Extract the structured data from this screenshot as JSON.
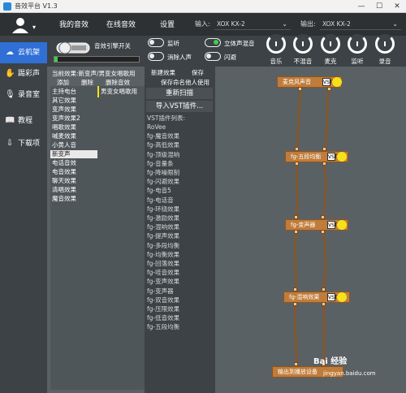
{
  "window": {
    "title": "音效平台 V1.3",
    "minimize": "—",
    "maximize": "☐",
    "close": "✕"
  },
  "tabs": [
    "我的音效",
    "在线音效",
    "设置"
  ],
  "input": {
    "label": "输入:",
    "value": "XOX KX-2"
  },
  "output": {
    "label": "输出:",
    "value": "XOX KX-2"
  },
  "sidebar": {
    "items": [
      "云机架",
      "踢彩声",
      "录音室",
      "教程",
      "下载项"
    ]
  },
  "engine": {
    "label": "音效引擎开关"
  },
  "switches": [
    {
      "label": "监听",
      "on": false
    },
    {
      "label": "立体声混音",
      "on": true
    },
    {
      "label": "消除人声",
      "on": false
    },
    {
      "label": "闪避",
      "on": false
    }
  ],
  "knobs": [
    "音乐",
    "不混音",
    "麦克",
    "监听",
    "录音"
  ],
  "current_effect": {
    "label": "当前效果:新变声/男变女唱歌用"
  },
  "actions": {
    "add": "添加",
    "delete": "删除",
    "delete_effect": "删除音效"
  },
  "effects_list": [
    "主持电台",
    "其它效果",
    "变声效果",
    "变声效果2",
    "唱歌效果",
    "喊麦效果",
    "小黄人音",
    "新变声",
    "电话音效",
    "电音效果",
    "聊天效果",
    "清唱效果",
    "魔音效果"
  ],
  "selected_effect": "新变声",
  "sub_list": [
    "男变女唱歌用"
  ],
  "mid": {
    "new_effect": "新建效果",
    "save": "保存",
    "save_named": "保存命名他人使用",
    "rescan": "重新扫描",
    "import_vst": "导入VST插件...",
    "vst_header": "VST插件列表:",
    "vst_list": [
      "RoVee",
      "fg-魔音效果",
      "fg-高低效果",
      "fg-顶级混响",
      "fg-音量条",
      "fg-降噪限制",
      "fg-闪避效果",
      "fg-电音5",
      "fg-电话音",
      "fg-环绕效果",
      "fg-激励效果",
      "fg-混响效果",
      "fg-提声效果",
      "fg-多段均衡",
      "fg-均衡效果",
      "fg-回落效果",
      "fg-哇音效果",
      "fg-变声效果",
      "fg-变声器",
      "fg-双音效果",
      "fg-压限效果",
      "fg-低音效果",
      "fg-五段均衡"
    ]
  },
  "graph": {
    "nodes": [
      "麦克风声音",
      "fg-五段均衡",
      "fg-变声器",
      "fg-混响效果",
      "输出到播放设备"
    ],
    "vst_tag": "VST"
  },
  "watermark": {
    "brand": "Bai 经验",
    "url": "jingyan.baidu.com"
  }
}
